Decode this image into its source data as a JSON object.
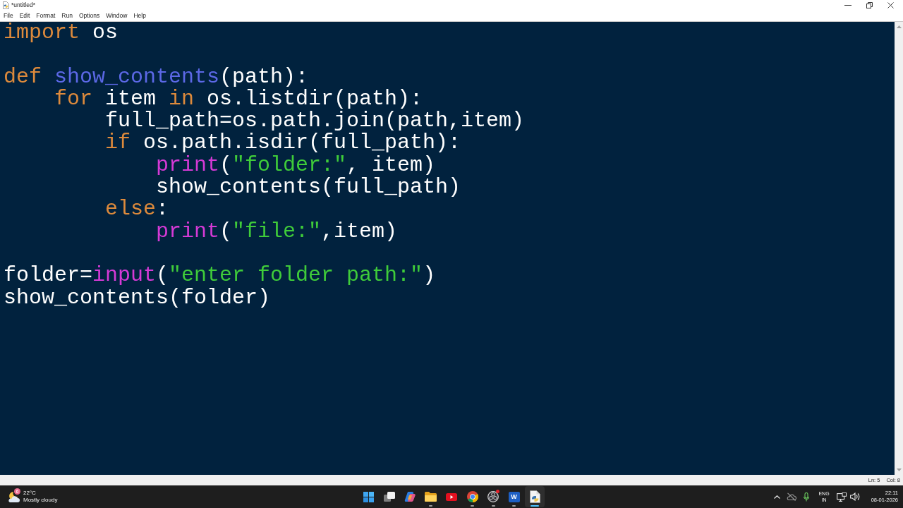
{
  "window": {
    "title": "*untitled*"
  },
  "menu": [
    "File",
    "Edit",
    "Format",
    "Run",
    "Options",
    "Window",
    "Help"
  ],
  "editor": {
    "blocks": [
      {
        "lines": [
          {
            "tokens": [
              {
                "kind": "keyword",
                "text": "import"
              },
              {
                "kind": "plain",
                "text": " os"
              }
            ]
          }
        ]
      },
      {
        "lines": [
          {
            "tokens": [
              {
                "kind": "keyword",
                "text": "def"
              },
              {
                "kind": "defname",
                "text": " show_contents"
              },
              {
                "kind": "plain",
                "text": "(path):"
              }
            ],
            "children": [
              {
                "tokens": [
                  {
                    "kind": "keyword",
                    "text": "for"
                  },
                  {
                    "kind": "plain",
                    "text": " item "
                  },
                  {
                    "kind": "keyword",
                    "text": "in"
                  },
                  {
                    "kind": "plain",
                    "text": " os.listdir(path):"
                  }
                ],
                "children": [
                  {
                    "tokens": [
                      {
                        "kind": "plain",
                        "text": "full_path=os.path.join(path,item)"
                      }
                    ]
                  },
                  {
                    "tokens": [
                      {
                        "kind": "keyword",
                        "text": "if"
                      },
                      {
                        "kind": "plain",
                        "text": " os.path.isdir(full_path):"
                      }
                    ],
                    "children": [
                      {
                        "tokens": [
                          {
                            "kind": "builtin",
                            "text": "print"
                          },
                          {
                            "kind": "plain",
                            "text": "("
                          },
                          {
                            "kind": "string",
                            "text": "\"folder:\""
                          },
                          {
                            "kind": "plain",
                            "text": ", item)"
                          }
                        ]
                      },
                      {
                        "tokens": [
                          {
                            "kind": "plain",
                            "text": "show_contents(full_path)"
                          }
                        ]
                      }
                    ]
                  },
                  {
                    "tokens": [
                      {
                        "kind": "keyword",
                        "text": "else"
                      },
                      {
                        "kind": "plain",
                        "text": ":"
                      }
                    ],
                    "children": [
                      {
                        "tokens": [
                          {
                            "kind": "builtin",
                            "text": "print"
                          },
                          {
                            "kind": "plain",
                            "text": "("
                          },
                          {
                            "kind": "string",
                            "text": "\"file:\""
                          },
                          {
                            "kind": "plain",
                            "text": ",item)"
                          }
                        ]
                      }
                    ]
                  }
                ]
              }
            ]
          }
        ]
      },
      {
        "lines": [
          {
            "tokens": [
              {
                "kind": "plain",
                "text": "folder="
              },
              {
                "kind": "builtin",
                "text": "input"
              },
              {
                "kind": "plain",
                "text": "("
              },
              {
                "kind": "string",
                "text": "\"enter folder path:\""
              },
              {
                "kind": "plain",
                "text": ")"
              }
            ]
          },
          {
            "tokens": [
              {
                "kind": "plain",
                "text": "show_contents(folder)"
              }
            ]
          }
        ]
      }
    ]
  },
  "status_bar": {
    "line": "Ln: 5",
    "column": "Col: 8"
  },
  "taskbar": {
    "weather": {
      "badge": "6",
      "temperature": "22°C",
      "condition": "Mostly cloudy"
    },
    "apps": [
      {
        "kind": "start",
        "running": false,
        "selected": false,
        "notification": false
      },
      {
        "kind": "task_view",
        "running": false,
        "selected": false,
        "notification": false
      },
      {
        "kind": "assistant",
        "running": false,
        "selected": false,
        "notification": false
      },
      {
        "kind": "files",
        "running": true,
        "selected": false,
        "notification": false
      },
      {
        "kind": "video",
        "running": false,
        "selected": false,
        "notification": false
      },
      {
        "kind": "browser",
        "running": true,
        "selected": false,
        "notification": false
      },
      {
        "kind": "recorder",
        "running": true,
        "selected": false,
        "notification": true
      },
      {
        "kind": "word",
        "label": "W",
        "running": true,
        "selected": false,
        "notification": false
      },
      {
        "kind": "idle",
        "running": true,
        "selected": true,
        "notification": false
      }
    ],
    "tray": {
      "language": "ENG",
      "region": "IN"
    },
    "clock": {
      "time": "22:11",
      "date": "08-01-2026"
    }
  }
}
